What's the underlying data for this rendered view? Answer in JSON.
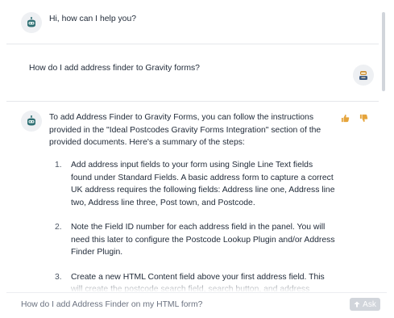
{
  "conversation": {
    "bot_greeting": "Hi, how can I help you?",
    "user_question": "How do I add address finder to Gravity forms?",
    "bot_answer_intro": "To add Address Finder to Gravity Forms, you can follow the instructions provided in the \"Ideal Postcodes Gravity Forms Integration\" section of the provided documents. Here's a summary of the steps:",
    "steps": [
      {
        "num": "1.",
        "text": "Add address input fields to your form using Single Line Text fields found under Standard Fields. A basic address form to capture a correct UK address requires the following fields: Address line one, Address line two, Address line three, Post town, and Postcode."
      },
      {
        "num": "2.",
        "text": "Note the Field ID number for each address field in the panel. You will need this later to configure the Postcode Lookup Plugin and/or Address Finder Plugin."
      },
      {
        "num": "3.",
        "text": "Create a new HTML Content field above your first address field. This will create the postcode search field, search button, and address dropdown"
      }
    ]
  },
  "icons": {
    "bot_avatar": "robot-icon",
    "user_avatar": "user-icon",
    "thumbs_up": "thumbs-up-icon",
    "thumbs_down": "thumbs-down-icon",
    "ask_arrow": "arrow-up-icon"
  },
  "input": {
    "placeholder": "How do I add Address Finder on my HTML form?",
    "ask_label": "Ask"
  },
  "colors": {
    "accent_feedback": "#e5a43b",
    "bot_avatar_body": "#2f6f73",
    "user_avatar_body": "#c98a2b",
    "ask_button": "#d1d5db"
  }
}
